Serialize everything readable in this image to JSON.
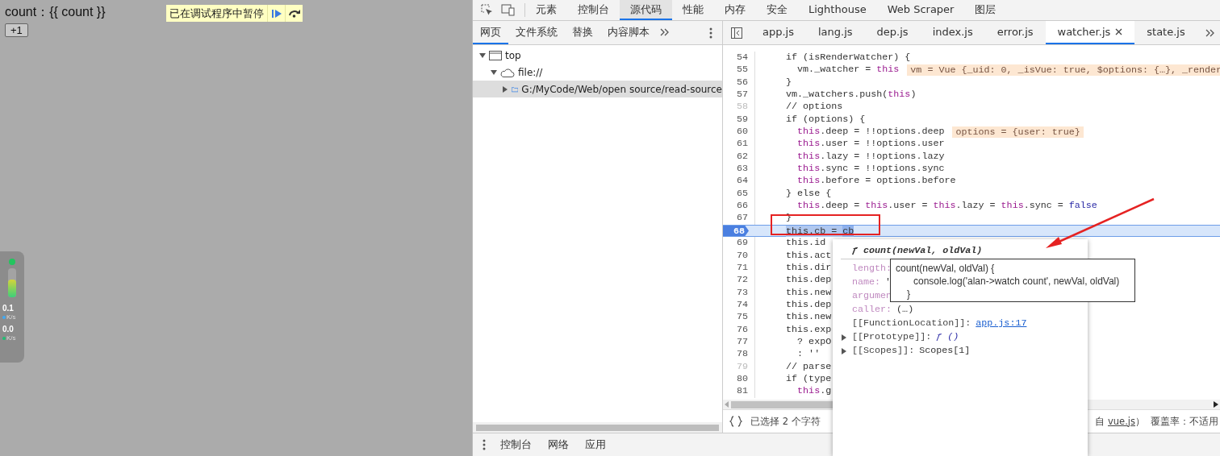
{
  "page": {
    "counter_label": "count：{{ count }}",
    "increment_button": "+1"
  },
  "paused_banner": {
    "message": "已在调试程序中暂停"
  },
  "net_monitor": {
    "rates": [
      {
        "value": "0.1",
        "unit": "K/s",
        "color": "#3fa9f5"
      },
      {
        "value": "0.0",
        "unit": "K/s",
        "color": "#1fbf73"
      }
    ]
  },
  "devtools": {
    "panel_tabs": [
      {
        "label": "元素",
        "selected": false
      },
      {
        "label": "控制台",
        "selected": false
      },
      {
        "label": "源代码",
        "selected": true
      },
      {
        "label": "性能",
        "selected": false
      },
      {
        "label": "内存",
        "selected": false
      },
      {
        "label": "安全",
        "selected": false
      },
      {
        "label": "Lighthouse",
        "selected": false
      },
      {
        "label": "Web Scraper",
        "selected": false
      },
      {
        "label": "图层",
        "selected": false
      }
    ],
    "navigator_tabs": [
      {
        "label": "网页",
        "selected": true
      },
      {
        "label": "文件系统",
        "selected": false
      },
      {
        "label": "替换",
        "selected": false
      },
      {
        "label": "内容脚本",
        "selected": false
      }
    ],
    "tree": [
      {
        "label": "top",
        "kind": "frame",
        "expanded": true,
        "selected": false,
        "children": [
          {
            "label": "file://",
            "kind": "origin",
            "expanded": true,
            "selected": false,
            "children": [
              {
                "label": "G:/MyCode/Web/open source/read-source",
                "kind": "folder",
                "expanded": false,
                "selected": true
              }
            ]
          }
        ]
      }
    ],
    "file_tabs": [
      {
        "label": "app.js",
        "selected": false
      },
      {
        "label": "lang.js",
        "selected": false
      },
      {
        "label": "dep.js",
        "selected": false
      },
      {
        "label": "index.js",
        "selected": false
      },
      {
        "label": "error.js",
        "selected": false
      },
      {
        "label": "watcher.js",
        "selected": true
      },
      {
        "label": "state.js",
        "selected": false
      }
    ],
    "code_lines": [
      {
        "number": "54",
        "dim": false,
        "current": false,
        "segments": [
          {
            "text": "    if (isRenderWatcher) {",
            "kind": "plain"
          }
        ]
      },
      {
        "number": "55",
        "dim": false,
        "current": false,
        "segments": [
          {
            "text": "      vm._watcher = ",
            "kind": "plain"
          },
          {
            "text": "this",
            "kind": "keyword"
          }
        ],
        "value": "vm = Vue {_uid: 0, _isVue: true, $options: {…}, _render"
      },
      {
        "number": "56",
        "dim": false,
        "current": false,
        "segments": [
          {
            "text": "    }",
            "kind": "plain"
          }
        ]
      },
      {
        "number": "57",
        "dim": false,
        "current": false,
        "segments": [
          {
            "text": "    vm._watchers.push(",
            "kind": "plain"
          },
          {
            "text": "this",
            "kind": "keyword"
          },
          {
            "text": ")",
            "kind": "plain"
          }
        ]
      },
      {
        "number": "58",
        "dim": true,
        "current": false,
        "segments": [
          {
            "text": "    // options",
            "kind": "plain"
          }
        ]
      },
      {
        "number": "59",
        "dim": false,
        "current": false,
        "segments": [
          {
            "text": "    if (options) {",
            "kind": "plain"
          }
        ]
      },
      {
        "number": "60",
        "dim": false,
        "current": false,
        "segments": [
          {
            "text": "      this",
            "kind": "keyword"
          },
          {
            "text": ".deep = !!options.deep",
            "kind": "plain"
          }
        ],
        "value": "options = {user: true}"
      },
      {
        "number": "61",
        "dim": false,
        "current": false,
        "segments": [
          {
            "text": "      this",
            "kind": "keyword"
          },
          {
            "text": ".user = !!options.user",
            "kind": "plain"
          }
        ]
      },
      {
        "number": "62",
        "dim": false,
        "current": false,
        "segments": [
          {
            "text": "      this",
            "kind": "keyword"
          },
          {
            "text": ".lazy = !!options.lazy",
            "kind": "plain"
          }
        ]
      },
      {
        "number": "63",
        "dim": false,
        "current": false,
        "segments": [
          {
            "text": "      this",
            "kind": "keyword"
          },
          {
            "text": ".sync = !!options.sync",
            "kind": "plain"
          }
        ]
      },
      {
        "number": "64",
        "dim": false,
        "current": false,
        "segments": [
          {
            "text": "      this",
            "kind": "keyword"
          },
          {
            "text": ".before = options.before",
            "kind": "plain"
          }
        ]
      },
      {
        "number": "65",
        "dim": false,
        "current": false,
        "segments": [
          {
            "text": "    } else {",
            "kind": "plain"
          }
        ]
      },
      {
        "number": "66",
        "dim": false,
        "current": false,
        "segments": [
          {
            "text": "      this",
            "kind": "keyword"
          },
          {
            "text": ".deep = ",
            "kind": "plain"
          },
          {
            "text": "this",
            "kind": "keyword"
          },
          {
            "text": ".user = ",
            "kind": "plain"
          },
          {
            "text": "this",
            "kind": "keyword"
          },
          {
            "text": ".lazy = ",
            "kind": "plain"
          },
          {
            "text": "this",
            "kind": "keyword"
          },
          {
            "text": ".sync = ",
            "kind": "plain"
          },
          {
            "text": "false",
            "kind": "literal"
          }
        ]
      },
      {
        "number": "67",
        "dim": false,
        "current": false,
        "segments": [
          {
            "text": "    }",
            "kind": "plain"
          }
        ]
      },
      {
        "number": "68",
        "dim": false,
        "current": true,
        "segments": [
          {
            "text": "    this.cb = ",
            "kind": "match"
          },
          {
            "text": "cb",
            "kind": "selection"
          }
        ]
      },
      {
        "number": "69",
        "dim": false,
        "current": false,
        "segments": [
          {
            "text": "    this.id",
            "kind": "plain"
          }
        ]
      },
      {
        "number": "70",
        "dim": false,
        "current": false,
        "segments": [
          {
            "text": "    this.act",
            "kind": "plain"
          }
        ]
      },
      {
        "number": "71",
        "dim": false,
        "current": false,
        "segments": [
          {
            "text": "    this.dir",
            "kind": "plain"
          }
        ]
      },
      {
        "number": "72",
        "dim": false,
        "current": false,
        "segments": [
          {
            "text": "    this.dep",
            "kind": "plain"
          }
        ]
      },
      {
        "number": "73",
        "dim": false,
        "current": false,
        "segments": [
          {
            "text": "    this.new",
            "kind": "plain"
          }
        ]
      },
      {
        "number": "74",
        "dim": false,
        "current": false,
        "segments": [
          {
            "text": "    this.dep",
            "kind": "plain"
          }
        ]
      },
      {
        "number": "75",
        "dim": false,
        "current": false,
        "segments": [
          {
            "text": "    this.new",
            "kind": "plain"
          }
        ]
      },
      {
        "number": "76",
        "dim": false,
        "current": false,
        "segments": [
          {
            "text": "    this.exp",
            "kind": "plain"
          }
        ]
      },
      {
        "number": "77",
        "dim": false,
        "current": false,
        "segments": [
          {
            "text": "      ? expO",
            "kind": "plain"
          }
        ]
      },
      {
        "number": "78",
        "dim": false,
        "current": false,
        "segments": [
          {
            "text": "      : ''",
            "kind": "plain"
          }
        ]
      },
      {
        "number": "79",
        "dim": true,
        "current": false,
        "segments": [
          {
            "text": "    // parse",
            "kind": "plain"
          }
        ]
      },
      {
        "number": "80",
        "dim": false,
        "current": false,
        "segments": [
          {
            "text": "    if (type",
            "kind": "plain"
          }
        ]
      },
      {
        "number": "81",
        "dim": false,
        "current": false,
        "segments": [
          {
            "text": "      this",
            "kind": "keyword"
          },
          {
            "text": ".g",
            "kind": "plain"
          }
        ]
      }
    ],
    "status": {
      "selection": "已选择 2 个字符",
      "source_prefix": "自 ",
      "source_link": "vue.js",
      "source_suffix": "）",
      "coverage": "覆盖率：不适用"
    },
    "drawer_tabs": [
      {
        "label": "控制台"
      },
      {
        "label": "网络"
      },
      {
        "label": "应用"
      }
    ]
  },
  "popover": {
    "title": "ƒ count(newVal, oldVal)",
    "properties": [
      {
        "key": "length:",
        "kind": "own",
        "expandable": false
      },
      {
        "key": "name:",
        "value": "'",
        "kind": "own",
        "expandable": false
      },
      {
        "key": "argumen",
        "kind": "own",
        "expandable": false
      },
      {
        "key": "caller:",
        "value": "(…)",
        "kind": "own",
        "expandable": false
      },
      {
        "key": "[[FunctionLocation]]:",
        "value": "app.js:17",
        "kind": "link",
        "expandable": false
      },
      {
        "key": "[[Prototype]]:",
        "value": "ƒ ()",
        "kind": "function",
        "expandable": true
      },
      {
        "key": "[[Scopes]]:",
        "value": "Scopes[1]",
        "kind": "internal",
        "expandable": true
      }
    ]
  },
  "tooltip": {
    "lines": [
      {
        "text": "count(newVal, oldVal) {",
        "kind": "open"
      },
      {
        "text": "console.log('alan->watch count', newVal, oldVal)",
        "kind": "body"
      },
      {
        "text": "}",
        "kind": "close"
      }
    ]
  }
}
